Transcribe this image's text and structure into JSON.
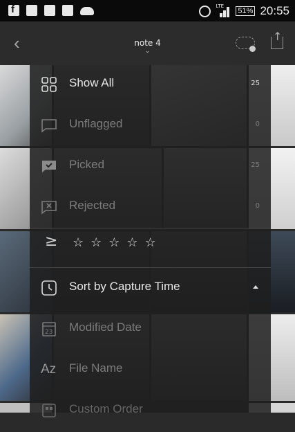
{
  "status_bar": {
    "lte_label": "LTE",
    "battery": "51%",
    "time": "20:55"
  },
  "header": {
    "back_icon": "chevron-left-icon",
    "title": "note 4",
    "cloud_icon": "cloud-sync-icon",
    "share_icon": "share-icon"
  },
  "menu": {
    "filter_items": [
      {
        "label": "Show All",
        "count": "25",
        "icon": "grid-icon"
      },
      {
        "label": "Unflagged",
        "count": "0",
        "icon": "flag-empty-icon"
      },
      {
        "label": "Picked",
        "count": "25",
        "icon": "flag-picked-icon"
      },
      {
        "label": "Rejected",
        "count": "0",
        "icon": "flag-rejected-icon"
      }
    ],
    "rating_symbol": "≥",
    "stars": "☆☆☆☆☆",
    "sort_items": [
      {
        "label": "Sort by Capture Time",
        "icon": "clock-icon"
      },
      {
        "label": "Modified Date",
        "icon": "calendar-icon"
      },
      {
        "label": "File Name",
        "icon": "az-icon",
        "icon_text": "Az"
      },
      {
        "label": "Custom Order",
        "icon": "custom-order-icon"
      }
    ]
  }
}
